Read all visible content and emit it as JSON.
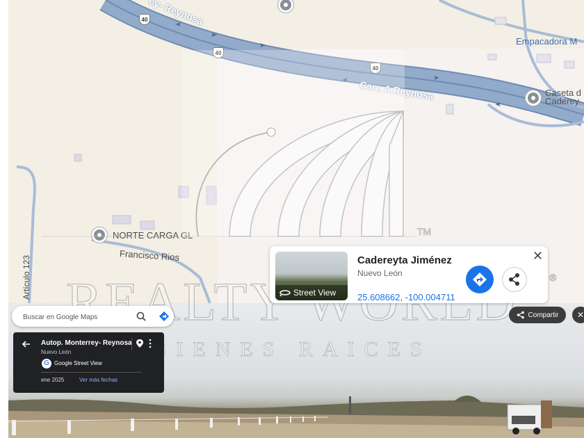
{
  "map": {
    "labels": {
      "highway_upper": "ey- Reynosa",
      "highway_main": "Carr. A Reynosa",
      "empacadora": "Empacadora M",
      "caseta_line1": "Caseta d",
      "caseta_line2": "Caderey",
      "norte_carga": "NORTE CARGA GL",
      "francisco_rios": "Francisco Rios",
      "articulo": "Artículo 123"
    },
    "shield_number": "40"
  },
  "watermark": {
    "brand": "REALTY WORLD",
    "tagline": "BIENES RAICES",
    "tm": "TM",
    "registered": "®"
  },
  "place_card": {
    "title": "Cadereyta Jiménez",
    "subtitle": "Nuevo León",
    "coordinates": "25.608662, -100.004711",
    "thumbnail_label": "Street View",
    "close_glyph": "✕"
  },
  "search": {
    "placeholder": "Buscar en Google Maps"
  },
  "street_view_panel": {
    "title": "Autop. Monterrey- Reynosa",
    "subtitle": "Nuevo León",
    "source": "Google Street View",
    "date": "ene 2025",
    "more_dates": "Ver más fechas"
  },
  "actions": {
    "share_label": "Compartir",
    "close_glyph": "✕"
  },
  "colors": {
    "road": "#8fa8c8",
    "road_edge": "#6f8bb3",
    "map_land": "#f3efe4",
    "accent_blue": "#1a73e8",
    "panel_dark": "#202124"
  }
}
